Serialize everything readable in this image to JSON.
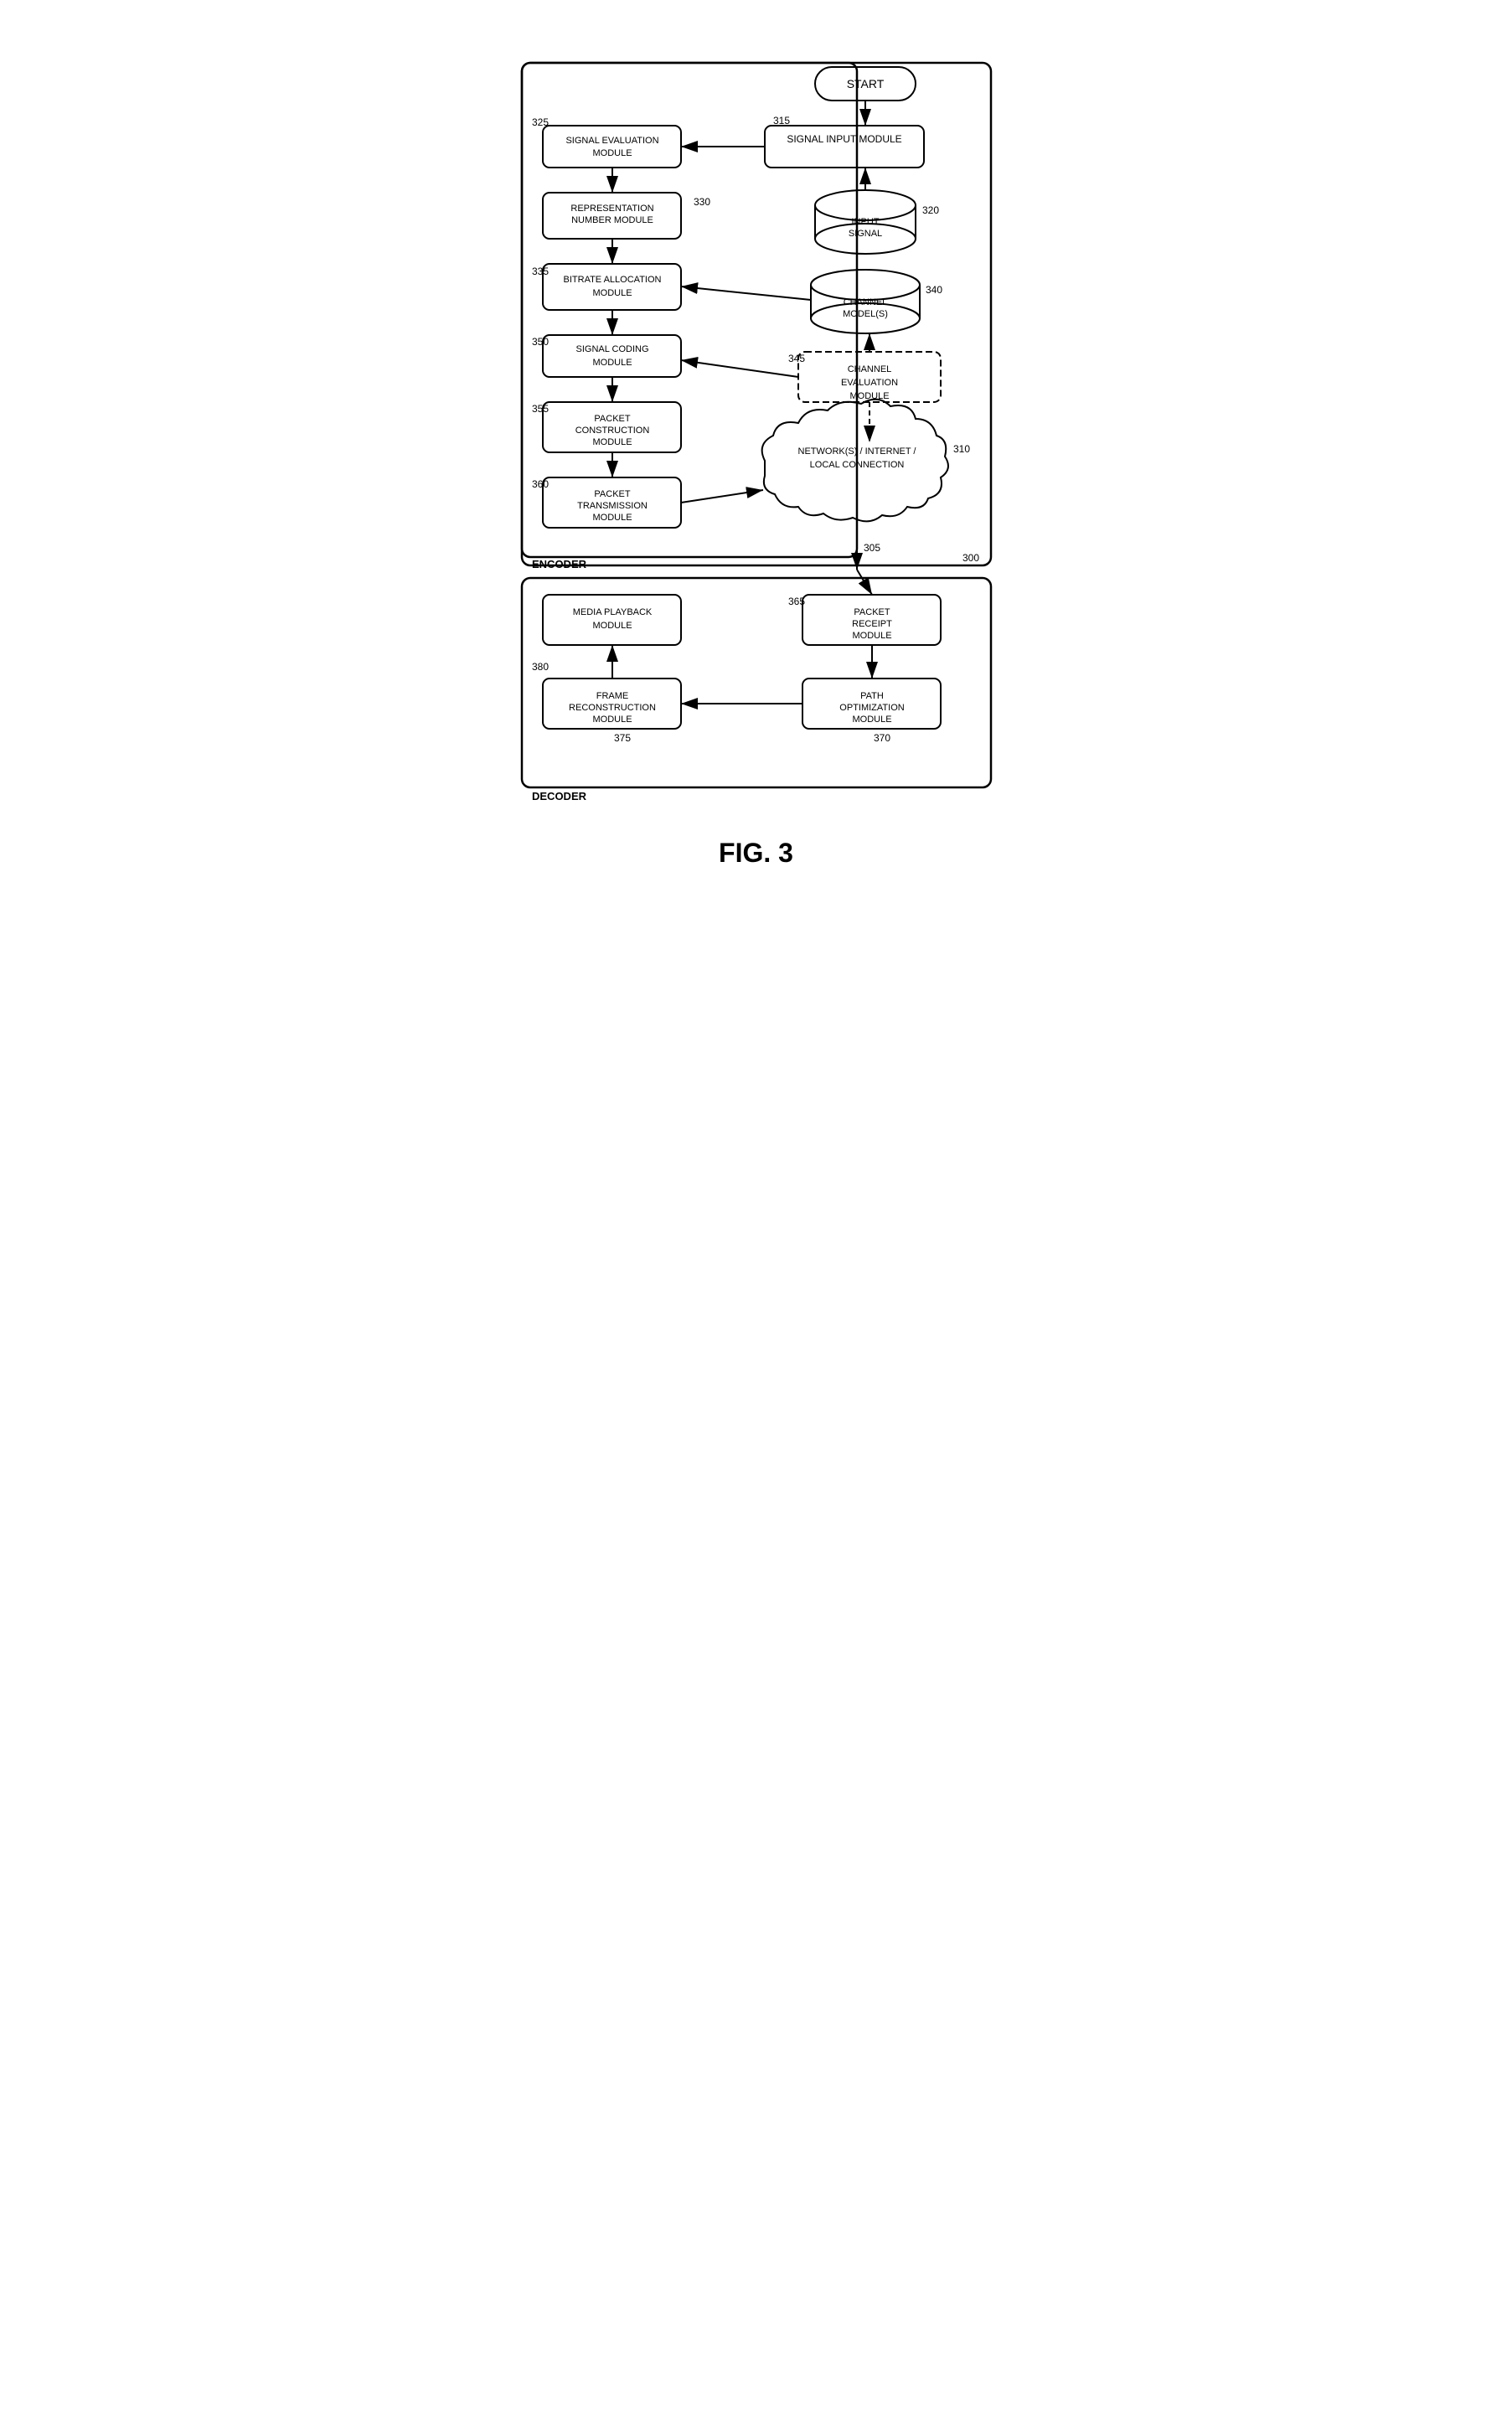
{
  "title": "FIG. 3",
  "nodes": {
    "start": "START",
    "signal_input": "SIGNAL INPUT MODULE",
    "signal_eval": "SIGNAL EVALUATION MODULE",
    "repr_number": "REPRESENTATION NUMBER MODULE",
    "bitrate_alloc": "BITRATE ALLOCATION MODULE",
    "signal_coding": "SIGNAL CODING MODULE",
    "packet_const": "PACKET CONSTRUCTION MODULE",
    "packet_trans": "PACKET TRANSMISSION MODULE",
    "input_signal": "INPUT SIGNAL",
    "channel_models": "CHANNEL MODEL(S)",
    "channel_eval": "CHANNEL EVALUATION MODULE",
    "network": "NETWORK(S) / INTERNET / LOCAL CONNECTION",
    "media_playback": "MEDIA PLAYBACK MODULE",
    "packet_receipt": "PACKET RECEIPT MODULE",
    "frame_recon": "FRAME RECONSTRUCTION MODULE",
    "path_opt": "PATH OPTIMIZATION MODULE",
    "encoder_label": "ENCODER",
    "decoder_label": "DECODER"
  },
  "labels": {
    "n300": "300",
    "n305": "305",
    "n310": "310",
    "n315": "315",
    "n320": "320",
    "n325": "325",
    "n330": "330",
    "n335": "335",
    "n340": "340",
    "n345": "345",
    "n350": "350",
    "n355": "355",
    "n360": "360",
    "n365": "365",
    "n370": "370",
    "n375": "375",
    "n380": "380"
  },
  "fig_label": "FIG. 3"
}
